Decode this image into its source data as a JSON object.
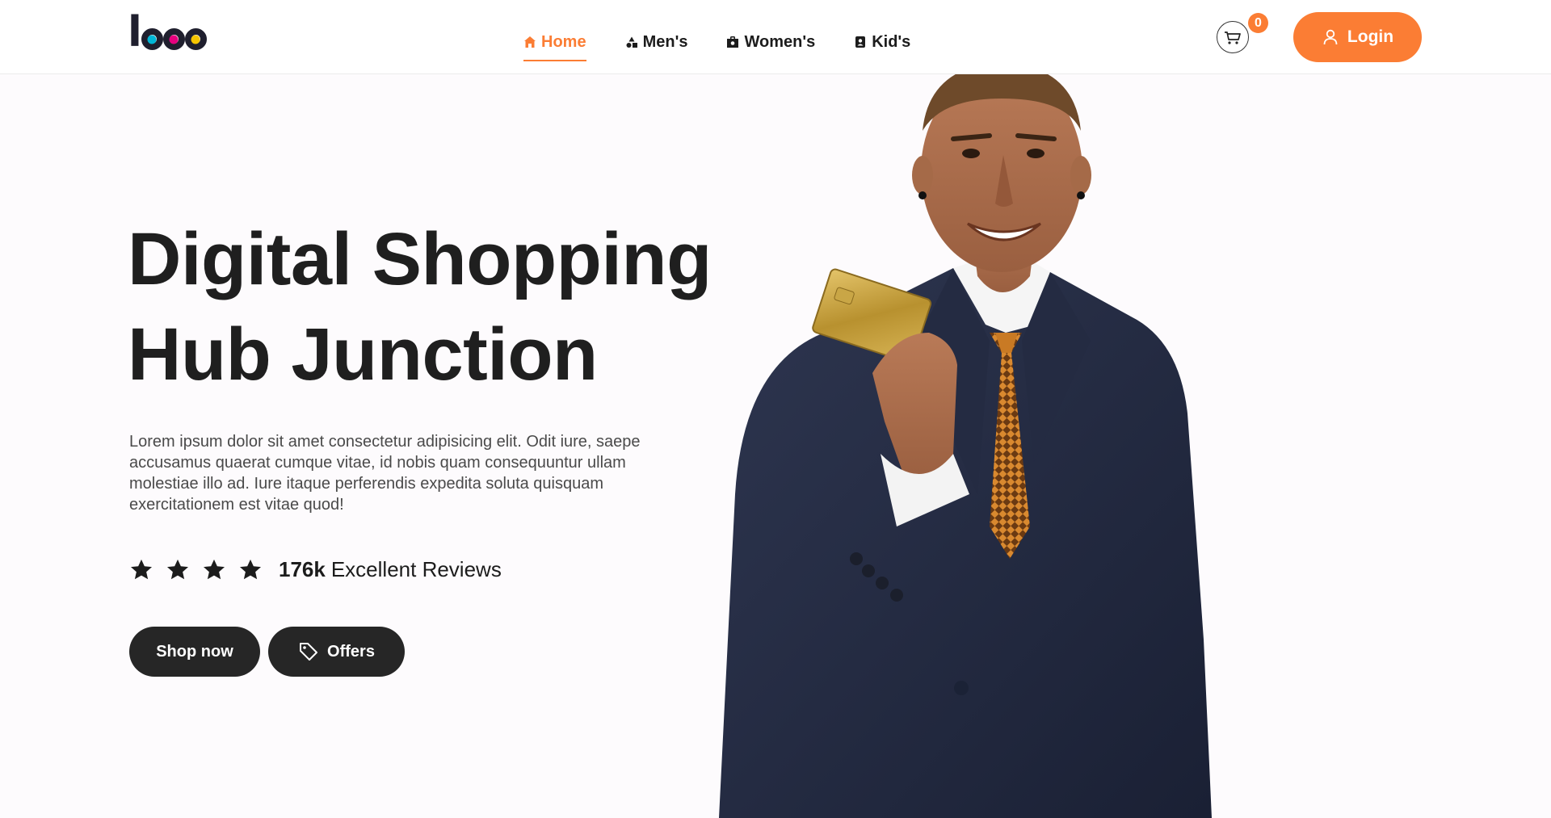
{
  "header": {
    "logo_text": "logo",
    "nav": [
      {
        "label": "Home",
        "icon": "home-icon",
        "active": true
      },
      {
        "label": "Men's",
        "icon": "shapes-icon",
        "active": false
      },
      {
        "label": "Women's",
        "icon": "bag-icon",
        "active": false
      },
      {
        "label": "Kid's",
        "icon": "kid-icon",
        "active": false
      }
    ],
    "cart_count": "0",
    "login_label": "Login"
  },
  "hero": {
    "title_line1": "Digital Shopping",
    "title_line2": "Hub Junction",
    "description": "Lorem ipsum dolor sit amet consectetur adipisicing elit. Odit iure, saepe accusamus quaerat cumque vitae, id nobis quam consequuntur ullam molestiae illo ad. Iure itaque perferendis expedita soluta quisquam exercitationem est vitae quod!",
    "rating_stars": 4,
    "rating_count": "176k",
    "rating_label": "Excellent Reviews",
    "shop_label": "Shop now",
    "offers_label": "Offers",
    "image_alt": "smiling man in navy suit holding gold credit card"
  },
  "colors": {
    "accent": "#fb7d34",
    "dark": "#262626",
    "logo_dot_1": "#00b6d6",
    "logo_dot_2": "#e6007e",
    "logo_dot_3": "#f5c400"
  }
}
